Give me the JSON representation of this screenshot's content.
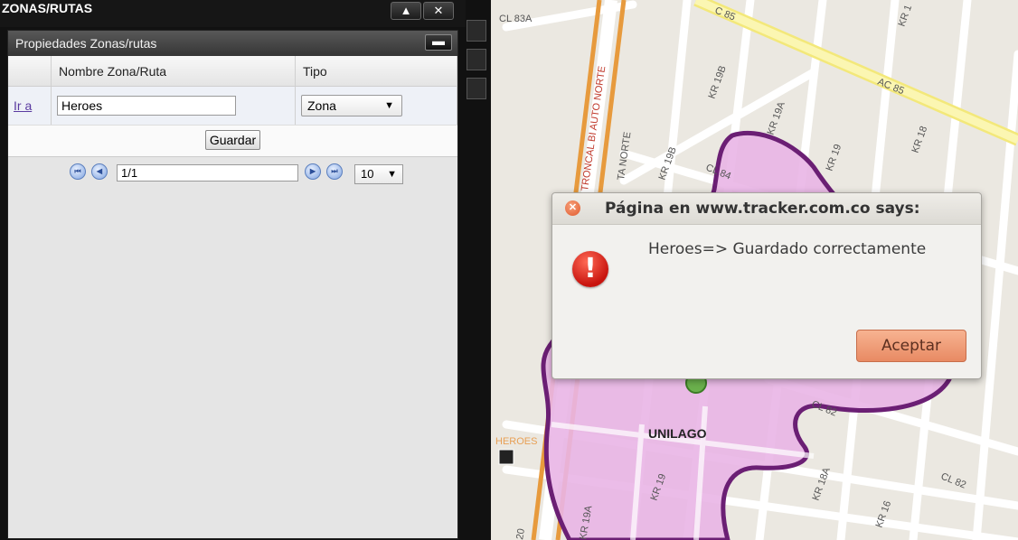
{
  "window": {
    "title": "ZONAS/RUTAS",
    "btn_up": "▲",
    "btn_close": "✕"
  },
  "panel": {
    "subheader": "Propiedades Zonas/rutas",
    "minimize": "▬",
    "columns": [
      "",
      "Nombre Zona/Ruta",
      "Tipo"
    ],
    "row": {
      "link": "Ir a",
      "name_value": "Heroes",
      "type_value": "Zona"
    },
    "save_label": "Guardar",
    "pager": {
      "page_value": "1/1",
      "page_size": "10"
    }
  },
  "map": {
    "labels": {
      "cl83a": "CL 83A",
      "cl85": "C 85",
      "ac85": "AC 85",
      "kr19b": "KR 19B",
      "kr19a": "KR 19A",
      "kr19": "KR 19",
      "kr18": "KR 18",
      "cl84": "CL 84",
      "kr19b2": "KR 19B",
      "trunk": "TRONCAL BI AUTO NORTE",
      "norte": "TA NORTE",
      "cl82": "CL 82",
      "cl82b": "CL 82",
      "kr18a": "KR 18A",
      "kr16": "KR 16",
      "kr19_bottom": "KR 19",
      "kr19a_bottom": "KR 19A",
      "heroes": "HEROES",
      "unilago": "UNILAGO",
      "kr1": "KR 1",
      "num20": "20"
    }
  },
  "dialog": {
    "title": "Página en www.tracker.com.co says:",
    "message": "Heroes=> Guardado correctamente",
    "ok_label": "Aceptar",
    "icon_glyph": "!"
  },
  "colors": {
    "zone_fill": "#e9b5e6",
    "zone_stroke": "#6b1f74",
    "arterial": "#f0a24a",
    "ok_button": "#e88a63"
  }
}
